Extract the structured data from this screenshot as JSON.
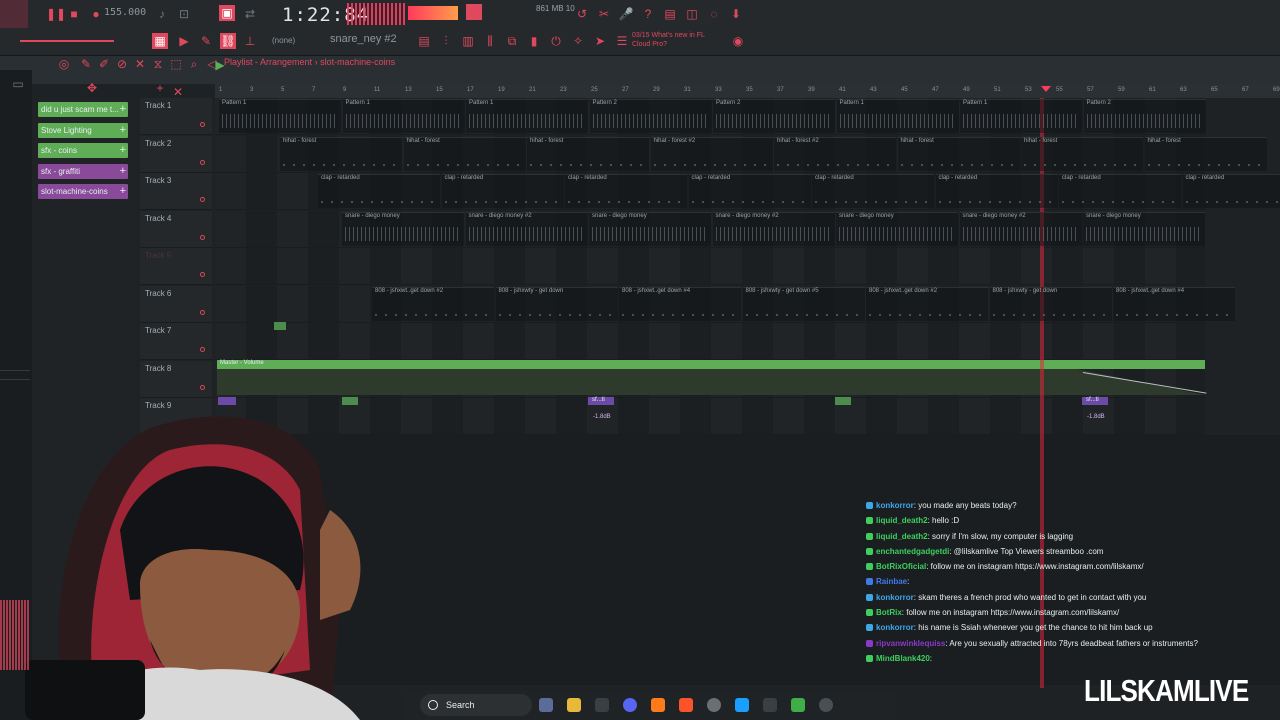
{
  "toolbar": {
    "tempo": "155.000",
    "time": "1:22:84",
    "cpu": "861 MB\n   10",
    "pattern": "snare_ney #2",
    "none": "(none)",
    "news": "03/15  What's new in FL Cloud Pro?"
  },
  "playlist": {
    "title": "Playlist - Arrangement",
    "pattern": "slot-machine-coins",
    "ruler_ticks": [
      "1",
      "3",
      "5",
      "7",
      "9",
      "11",
      "13",
      "15",
      "17",
      "19",
      "21",
      "23",
      "25",
      "27",
      "29",
      "31",
      "33",
      "35",
      "37",
      "39",
      "41",
      "43",
      "45",
      "47",
      "49",
      "51",
      "53",
      "55",
      "57",
      "59",
      "61",
      "63",
      "65",
      "67",
      "69"
    ]
  },
  "picker": [
    {
      "label": "did u just scam me t...",
      "color": "#5fae57"
    },
    {
      "label": "Stove Lighting",
      "color": "#5fae57"
    },
    {
      "label": "sfx - coins",
      "color": "#5fae57"
    },
    {
      "label": "sfx - graffiti",
      "color": "#8a4a9a"
    },
    {
      "label": "slot-machine-coins",
      "color": "#8a4a9a"
    }
  ],
  "tracks": [
    {
      "name": "Track 1"
    },
    {
      "name": "Track 2"
    },
    {
      "name": "Track 3"
    },
    {
      "name": "Track 4"
    },
    {
      "name": "Track 5"
    },
    {
      "name": "Track 6"
    },
    {
      "name": "Track 7"
    },
    {
      "name": "Track 8"
    },
    {
      "name": "Track 9"
    }
  ],
  "clips": {
    "t1": [
      "Pattern 1",
      "Pattern 1",
      "Pattern 1",
      "Pattern 2",
      "Pattern 2",
      "Pattern 1",
      "Pattern 1",
      "Pattern 2"
    ],
    "t2": [
      "hihat - forest",
      "hihat - forest",
      "hihat - forest",
      "hihat - forest #2",
      "hihat - forest #2",
      "hihat - forest",
      "hihat - forest",
      "hihat - forest"
    ],
    "t3": [
      "clap - retarded",
      "clap - retarded",
      "clap - retarded",
      "clap - retarded",
      "clap - retarded",
      "clap - retarded",
      "clap - retarded",
      "clap - retarded"
    ],
    "t4": [
      "snare - diego money",
      "snare - diego money #2",
      "snare - diego money",
      "snare - diego money #2",
      "snare - diego money",
      "snare - diego money #2",
      "snare - diego money"
    ],
    "t6": [
      "808 - jshxwt..get down #2",
      "808 - jshxwty - get down",
      "808 - jshxwt..get down #4",
      "808 - jshxwty - get down #5",
      "808 - jshxwt..get down #2",
      "808 - jshxwty - get down",
      "808 - jshxwt..get down #4"
    ],
    "t8": "Master - Volume",
    "t9": [
      "sf...ti",
      "sf...ti"
    ],
    "t9_db": "-1.8dB"
  },
  "chat": [
    {
      "user": "konkorror",
      "color": "#3fa6e8",
      "msg": ": you made any beats today?"
    },
    {
      "user": "liquid_death2",
      "color": "#3ecf5e",
      "msg": ": hello :D"
    },
    {
      "user": "liquid_death2",
      "color": "#3ecf5e",
      "msg": ": sorry if I'm slow, my computer is lagging"
    },
    {
      "user": "enchantedgadgetdi",
      "color": "#3ecf5e",
      "msg": ": @lilskamlive Top Viewers streamboo .com"
    },
    {
      "user": "BotRixOficial",
      "color": "#3ecf5e",
      "msg": ": follow me on instagram https://www.instagram.com/lilskamx/"
    },
    {
      "user": "Rainbae",
      "color": "#3f7be8",
      "msg": ":"
    },
    {
      "user": "konkorror",
      "color": "#3fa6e8",
      "msg": ": skam theres a french prod who wanted to get in contact with you"
    },
    {
      "user": "BotRix",
      "color": "#3ecf5e",
      "msg": ": follow me on instagram https://www.instagram.com/lilskamx/"
    },
    {
      "user": "konkorror",
      "color": "#3fa6e8",
      "msg": ": his name is Ssiah whenever you get the chance to hit him back up"
    },
    {
      "user": "ripvanwinklequiss",
      "color": "#8a3ac9",
      "msg": ": Are you sexually attracted into 78yrs deadbeat fathers or instruments?"
    },
    {
      "user": "MindBlank420",
      "color": "#3ecf5e",
      "msg": ":"
    }
  ],
  "taskbar": {
    "search": "Search"
  },
  "brand": "LILSKAMLIVE"
}
